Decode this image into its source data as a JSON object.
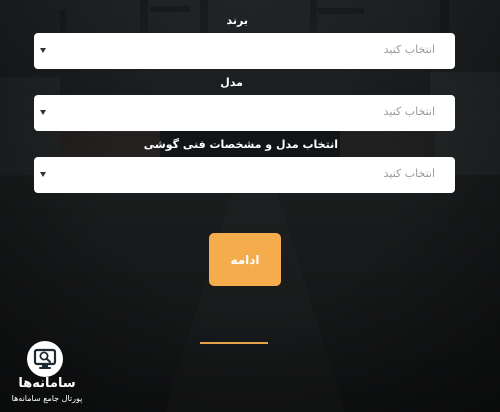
{
  "form": {
    "brand_label": "برند",
    "model_label": "مدل",
    "spec_label": "انتخاب مدل و مشخصات فنی گوشی",
    "brand_select": {
      "value": "انتخاب کنید"
    },
    "model_select": {
      "value": "انتخاب کنید"
    },
    "spec_select": {
      "value": "انتخاب کنید"
    },
    "continue_label": "ادامه"
  },
  "watermark": {
    "name": "سامانه‌ها",
    "tagline": "پورتال جامع سامانه‌ها"
  },
  "colors": {
    "accent": "#f5ac4c",
    "select_bg": "#ffffff",
    "placeholder_text": "#9a9a9a",
    "label_text": "#ffffff"
  },
  "icons": {
    "dropdown": "chevron-down-icon",
    "logo": "monitor-search-icon"
  }
}
